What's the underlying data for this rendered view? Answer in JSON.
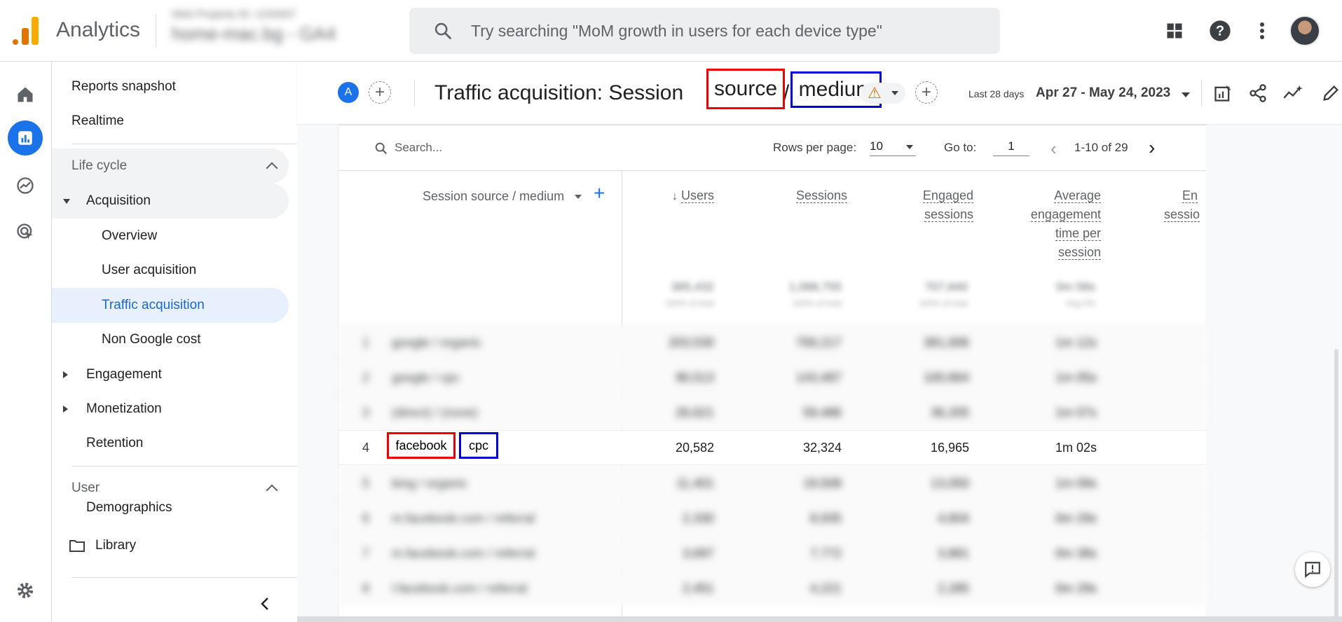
{
  "topbar": {
    "app_title": "Analytics",
    "account_line1": "Web Property ID: 1234567",
    "account_line2": "home-mac.bg - GA4",
    "search_placeholder": "Try searching \"MoM growth in users for each device type\""
  },
  "sidenav": {
    "reports_snapshot": "Reports snapshot",
    "realtime": "Realtime",
    "section_lifecycle": "Life cycle",
    "acquisition": "Acquisition",
    "overview": "Overview",
    "user_acquisition": "User acquisition",
    "traffic_acquisition": "Traffic acquisition",
    "non_google_cost": "Non Google cost",
    "engagement": "Engagement",
    "monetization": "Monetization",
    "retention": "Retention",
    "section_user": "User",
    "demographics": "Demographics",
    "library": "Library"
  },
  "header": {
    "comparison_badge": "A",
    "title_prefix": "Traffic acquisition: Session",
    "title_source": "source",
    "title_slash": "/",
    "title_medium": "medium",
    "date_label": "Last 28 days",
    "date_range": "Apr 27 - May 24, 2023"
  },
  "table": {
    "search_placeholder": "Search...",
    "rows_per_page_label": "Rows per page:",
    "rows_per_page": "10",
    "goto_label": "Go to:",
    "goto_value": "1",
    "pagination": "1-10 of 29",
    "dimension_header": "Session source / medium",
    "metric_headers": {
      "users": "Users",
      "sessions": "Sessions",
      "engaged_1": "Engaged",
      "engaged_2": "sessions",
      "avg_1": "Average",
      "avg_2": "engagement",
      "avg_3": "time per",
      "avg_4": "session",
      "er_1": "En",
      "er_2": "sessio"
    },
    "totals": {
      "users": "385,432",
      "sessions": "1,088,755",
      "engaged": "707,840",
      "avg": "0m 58s",
      "users_sub": "100% of total",
      "sessions_sub": "100% of total",
      "engaged_sub": "100% of total",
      "avg_sub": "Avg 0%"
    },
    "rows": [
      {
        "idx": "1",
        "dim": "google / organic",
        "users": "203,530",
        "sessions": "700,217",
        "engaged": "381,006",
        "avg": "1m 12s"
      },
      {
        "idx": "2",
        "dim": "google / cpc",
        "users": "90,513",
        "sessions": "143,487",
        "engaged": "100,664",
        "avg": "1m 05s"
      },
      {
        "idx": "3",
        "dim": "(direct) / (none)",
        "users": "26,621",
        "sessions": "59,486",
        "engaged": "36,205",
        "avg": "1m 07s"
      },
      {
        "idx": "4",
        "dim_source": "facebook",
        "dim_medium": "cpc",
        "users": "20,582",
        "sessions": "32,324",
        "engaged": "16,965",
        "avg": "1m 02s"
      },
      {
        "idx": "5",
        "dim": "bing / organic",
        "users": "11,401",
        "sessions": "19,508",
        "engaged": "13,050",
        "avg": "1m 09s"
      },
      {
        "idx": "6",
        "dim": "m.facebook.com / referral",
        "users": "2,330",
        "sessions": "8,935",
        "engaged": "4,604",
        "avg": "0m 29s"
      },
      {
        "idx": "7",
        "dim": "m.facebook.com / referral",
        "users": "3,697",
        "sessions": "7,772",
        "engaged": "3,881",
        "avg": "0m 38s"
      },
      {
        "idx": "8",
        "dim": "l.facebook.com / referral",
        "users": "2,451",
        "sessions": "4,221",
        "engaged": "2,285",
        "avg": "0m 29s"
      }
    ]
  },
  "colors": {
    "accent": "#1a73e8",
    "highlight_source": "#e00000",
    "highlight_medium": "#0000d8",
    "logo_orange": "#f9ab00"
  }
}
